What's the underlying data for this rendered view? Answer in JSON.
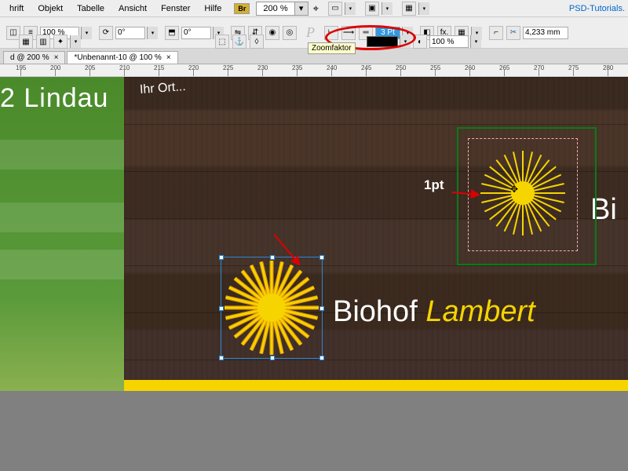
{
  "menu": {
    "items": [
      "hrift",
      "Objekt",
      "Tabelle",
      "Ansicht",
      "Fenster",
      "Hilfe"
    ],
    "br": "Br",
    "zoom": "200 %",
    "psd": "PSD-Tutorials."
  },
  "toolbar": {
    "pct1": "100 %",
    "deg1": "0°",
    "deg2": "0°",
    "stroke": "3 Pt",
    "pct2": "100 %",
    "mm": "4,233 mm",
    "tooltip": "Zoomfaktor"
  },
  "tabs": {
    "t1": "d @ 200 %",
    "close1": "×",
    "t2": "*Unbenannt-10 @ 100 %",
    "close2": "×"
  },
  "ruler": [
    195,
    200,
    205,
    210,
    215,
    220,
    225,
    230,
    235,
    240,
    245,
    250,
    255,
    260,
    265,
    270,
    275,
    280
  ],
  "content": {
    "lindau": "2 Lindau",
    "ihr": "Ihr Ort...",
    "biohof": "Biohof ",
    "lambert": "Lambert",
    "bi": "Bi",
    "pt": "1pt"
  }
}
